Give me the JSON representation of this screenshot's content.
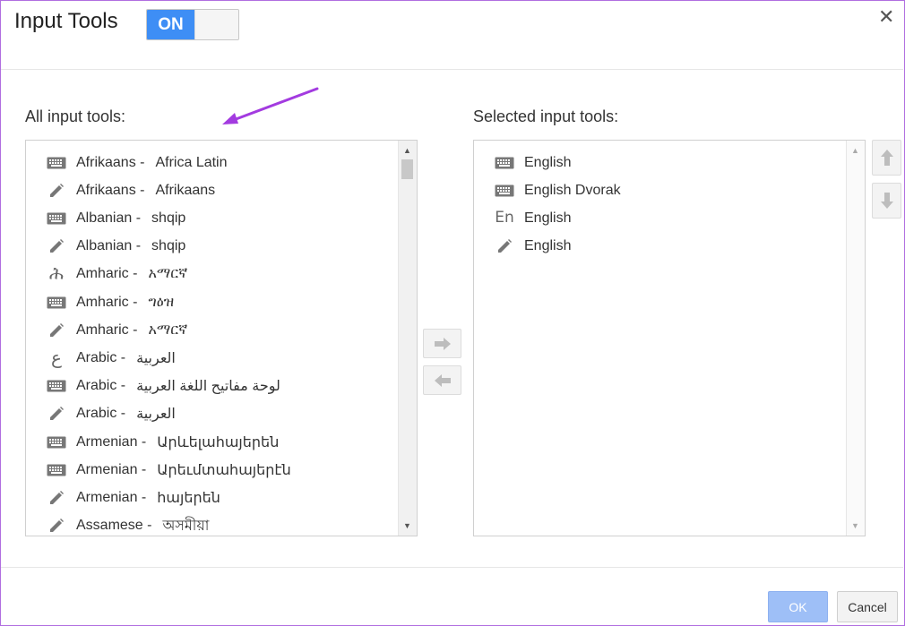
{
  "dialog": {
    "title": "Input Tools",
    "toggle_label": "ON",
    "close_glyph": "✕"
  },
  "left_panel": {
    "label": "All input tools:",
    "items": [
      {
        "icon": "keyboard-icon",
        "lang": "Afrikaans -",
        "native": "Africa Latin"
      },
      {
        "icon": "pencil-icon",
        "lang": "Afrikaans -",
        "native": "Afrikaans"
      },
      {
        "icon": "keyboard-icon",
        "lang": "Albanian -",
        "native": "shqip"
      },
      {
        "icon": "pencil-icon",
        "lang": "Albanian -",
        "native": "shqip"
      },
      {
        "icon": "amharic-glyph-icon",
        "lang": "Amharic -",
        "native": "አማርኛ"
      },
      {
        "icon": "keyboard-icon",
        "lang": "Amharic -",
        "native": "ግዕዝ"
      },
      {
        "icon": "pencil-icon",
        "lang": "Amharic -",
        "native": "አማርኛ"
      },
      {
        "icon": "arabic-glyph-icon",
        "lang": "Arabic -",
        "native": "العربية"
      },
      {
        "icon": "keyboard-icon",
        "lang": "Arabic -",
        "native": "لوحة مفاتيح اللغة العربية"
      },
      {
        "icon": "pencil-icon",
        "lang": "Arabic -",
        "native": "العربية"
      },
      {
        "icon": "keyboard-icon",
        "lang": "Armenian -",
        "native": "Արևելահայերեն"
      },
      {
        "icon": "keyboard-icon",
        "lang": "Armenian -",
        "native": "Արեւմտահայերէն"
      },
      {
        "icon": "pencil-icon",
        "lang": "Armenian -",
        "native": "հայերեն"
      },
      {
        "icon": "pencil-icon",
        "lang": "Assamese -",
        "native": "অসমীয়া"
      }
    ]
  },
  "right_panel": {
    "label": "Selected input tools:",
    "items": [
      {
        "icon": "keyboard-icon",
        "lang": "English"
      },
      {
        "icon": "keyboard-icon",
        "lang": "English Dvorak"
      },
      {
        "icon": "en-glyph-icon",
        "lang": "English"
      },
      {
        "icon": "pencil-icon",
        "lang": "English"
      }
    ]
  },
  "buttons": {
    "ok": "OK",
    "cancel": "Cancel"
  },
  "colors": {
    "toggle_on": "#3e8ef5",
    "ok_button": "#9ebff7",
    "annotation_arrow": "#a33be0",
    "icon": "#666666"
  }
}
